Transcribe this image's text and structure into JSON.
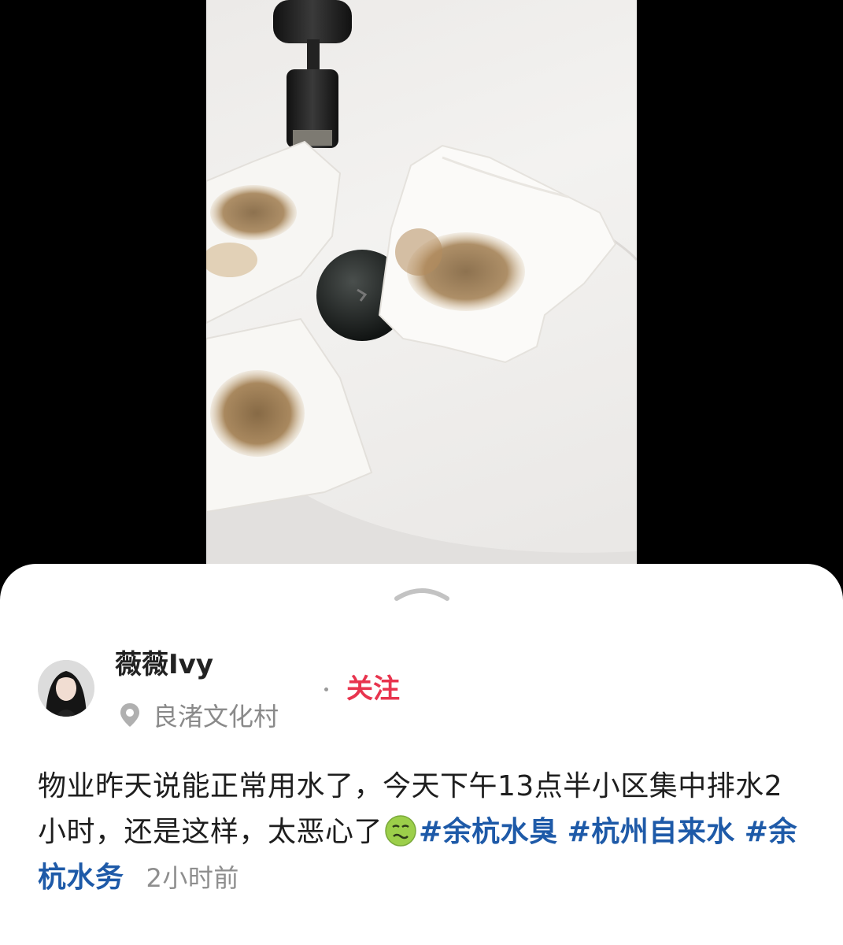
{
  "post": {
    "username": "薇薇Ivy",
    "follow_label": "关注",
    "location": "良渚文化村",
    "text_main": "物业昨天说能正常用水了，今天下午13点半小区集中排水2小时，还是这样，太恶心了",
    "emoji": "nauseated-face",
    "hashtags": [
      "#余杭水臭",
      "#杭州自来水",
      "#余杭水务"
    ],
    "time_ago": "2小时前"
  },
  "colors": {
    "follow": "#e8344e",
    "hashtag": "#1e5aa8",
    "secondary_text": "#8e8e8e"
  },
  "icons": {
    "handle": "chevron-up-icon",
    "location": "location-pin-icon"
  }
}
